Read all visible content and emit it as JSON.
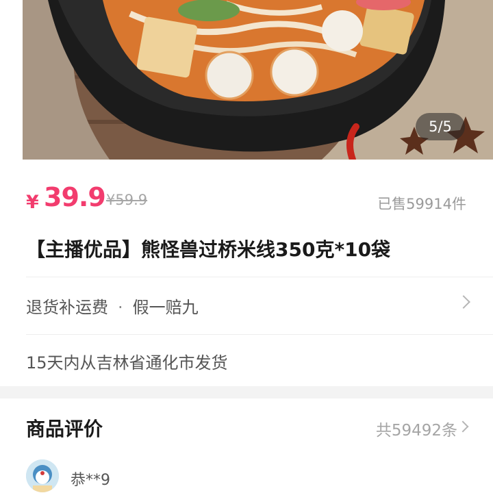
{
  "gallery": {
    "indicator": "5/5"
  },
  "product": {
    "currency_symbol": "¥",
    "price": "39.9",
    "original_price": "¥59.9",
    "sold": "已售59914件",
    "title": "【主播优品】熊怪兽过桥米线350克*10袋"
  },
  "services": {
    "item1": "退货补运费",
    "separator": "·",
    "item2": "假一赔九"
  },
  "shipping": "15天内从吉林省通化市发货",
  "reviews": {
    "heading": "商品评价",
    "count": "共59492条",
    "first_reviewer": "恭**9"
  },
  "colors": {
    "price": "#f23c6e",
    "muted": "#9a9a9a"
  }
}
